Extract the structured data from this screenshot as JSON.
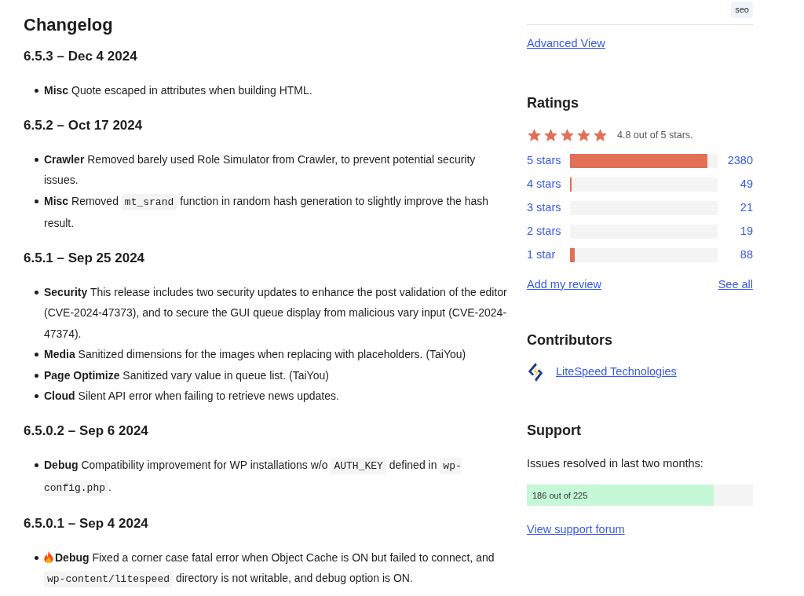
{
  "changelog": {
    "title": "Changelog",
    "releases": [
      {
        "version": "6.5.3 – Dec 4 2024",
        "items": [
          {
            "tag": "Misc",
            "hot": false,
            "parts": [
              {
                "kind": "text",
                "text": "Quote escaped in attributes when building HTML."
              }
            ]
          }
        ]
      },
      {
        "version": "6.5.2 – Oct 17 2024",
        "items": [
          {
            "tag": "Crawler",
            "hot": false,
            "parts": [
              {
                "kind": "text",
                "text": "Removed barely used Role Simulator from Crawler, to prevent potential security issues."
              }
            ]
          },
          {
            "tag": "Misc",
            "hot": false,
            "parts": [
              {
                "kind": "text",
                "text": "Removed "
              },
              {
                "kind": "code",
                "text": "mt_srand"
              },
              {
                "kind": "text",
                "text": " function in random hash generation to slightly improve the hash result."
              }
            ]
          }
        ]
      },
      {
        "version": "6.5.1 – Sep 25 2024",
        "items": [
          {
            "tag": "Security",
            "hot": false,
            "parts": [
              {
                "kind": "text",
                "text": "This release includes two security updates to enhance the post validation of the editor (CVE-2024-47373), and to secure the GUI queue display from malicious vary input (CVE-2024-47374)."
              }
            ]
          },
          {
            "tag": "Media",
            "hot": false,
            "parts": [
              {
                "kind": "text",
                "text": "Sanitized dimensions for the images when replacing with placeholders. (TaiYou)"
              }
            ]
          },
          {
            "tag": "Page Optimize",
            "hot": false,
            "parts": [
              {
                "kind": "text",
                "text": "Sanitized vary value in queue list. (TaiYou)"
              }
            ]
          },
          {
            "tag": "Cloud",
            "hot": false,
            "parts": [
              {
                "kind": "text",
                "text": "Silent API error when failing to retrieve news updates."
              }
            ]
          }
        ]
      },
      {
        "version": "6.5.0.2 – Sep 6 2024",
        "items": [
          {
            "tag": "Debug",
            "hot": false,
            "parts": [
              {
                "kind": "text",
                "text": "Compatibility improvement for WP installations w/o "
              },
              {
                "kind": "code",
                "text": "AUTH_KEY"
              },
              {
                "kind": "text",
                "text": " defined in "
              },
              {
                "kind": "code",
                "text": "wp-config.php"
              },
              {
                "kind": "text",
                "text": "."
              }
            ]
          }
        ]
      },
      {
        "version": "6.5.0.1 – Sep 4 2024",
        "items": [
          {
            "tag": "Debug",
            "hot": true,
            "parts": [
              {
                "kind": "text",
                "text": "Fixed a corner case fatal error when Object Cache is ON but failed to connect, and "
              },
              {
                "kind": "code",
                "text": "wp-content/litespeed"
              },
              {
                "kind": "text",
                "text": " directory is not writable, and debug option is ON."
              }
            ]
          }
        ]
      }
    ]
  },
  "sidebar": {
    "tag": "seo",
    "advanced_link": "Advanced View",
    "ratings": {
      "title": "Ratings",
      "stars": 5,
      "summary": "4.8 out of 5 stars.",
      "rows": [
        {
          "label": "5 stars",
          "level": 0.93,
          "count": "2380"
        },
        {
          "label": "4 stars",
          "level": 0.01,
          "count": "49"
        },
        {
          "label": "3 stars",
          "level": 0,
          "count": "21"
        },
        {
          "label": "2 stars",
          "level": 0,
          "count": "19"
        },
        {
          "label": "1 star",
          "level": 0.03,
          "count": "88"
        }
      ],
      "add_review": "Add my review",
      "see_all": "See all"
    },
    "contributors": {
      "title": "Contributors",
      "names": [
        "LiteSpeed Technologies"
      ]
    },
    "support": {
      "title": "Support",
      "text": "Issues resolved in last two months:",
      "level": 0.826,
      "reading": "186 out of 225",
      "forum_link": "View support forum"
    }
  }
}
